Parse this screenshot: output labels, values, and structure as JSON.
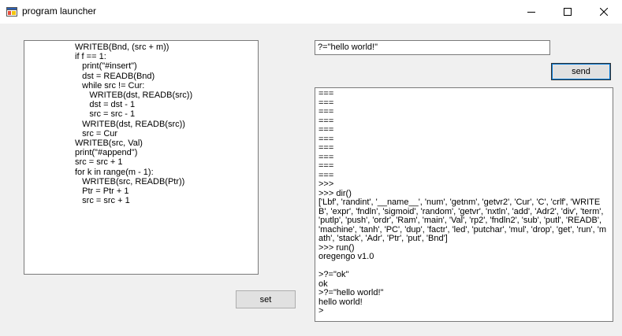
{
  "window": {
    "title": "program launcher",
    "icon": "app-window-icon"
  },
  "editor": {
    "lines": [
      "WRITEB(Bnd, (src + m))",
      "if f == 1:",
      "   print(\"#insert\")",
      "   dst = READB(Bnd)",
      "   while src != Cur:",
      "      WRITEB(dst, READB(src))",
      "      dst = dst - 1",
      "      src = src - 1",
      "   WRITEB(dst, READB(src))",
      "   src = Cur",
      "WRITEB(src, Val)",
      "print(\"#append\")",
      "src = src + 1",
      "for k in range(m - 1):",
      "   WRITEB(src, READB(Ptr))",
      "   Ptr = Ptr + 1",
      "   src = src + 1"
    ]
  },
  "command": {
    "value": "?=\"hello world!\""
  },
  "buttons": {
    "send": "send",
    "set": "set"
  },
  "console": {
    "lines": [
      "===",
      "===",
      "===",
      "===",
      "===",
      "===",
      "===",
      "===",
      "===",
      "===",
      ">>>",
      ">>> dir()",
      "['Lbf', 'randint', '__name__', 'num', 'getnm', 'getvr2', 'Cur', 'C', 'crlf', 'WRITEB', 'expr', 'fndln', 'sigmoid', 'random', 'getvr', 'nxtln', 'add', 'Adr2', 'div', 'term', 'putlp', 'push', 'ordr', 'Ram', 'main', 'Val', 'rp2', 'fndln2', 'sub', 'putl', 'READB', 'machine', 'tanh', 'PC', 'dup', 'factr', 'led', 'putchar', 'mul', 'drop', 'get', 'run', 'math', 'stack', 'Adr', 'Ptr', 'put', 'Bnd']",
      ">>> run()",
      "oregengo v1.0",
      "",
      ">?=\"ok\"",
      "ok",
      ">?=\"hello world!\"",
      "hello world!",
      ">"
    ]
  }
}
